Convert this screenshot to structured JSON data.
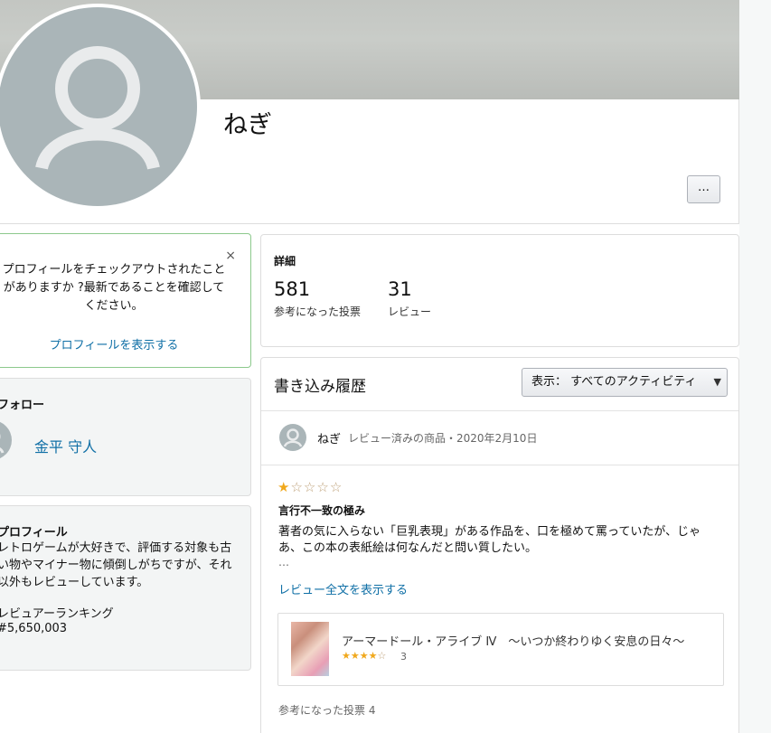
{
  "profile": {
    "name": "ねぎ",
    "more_label": "…"
  },
  "notice": {
    "close_label": "×",
    "text": "プロフィールをチェックアウトされたことがありますか ?最新であることを確認してください。",
    "link": "プロフィールを表示する"
  },
  "following": {
    "title": "フォロー",
    "name": "金平 守人"
  },
  "about": {
    "title": "プロフィール",
    "bio": "レトロゲームが大好きで、評価する対象も古い物やマイナー物に傾倒しがちですが、それ以外もレビューしています。",
    "ranking_label": "レビュアーランキング",
    "ranking_value": "#5,650,003"
  },
  "details": {
    "title": "詳細",
    "helpful_votes": "581",
    "helpful_votes_label": "参考になった投票",
    "reviews": "31",
    "reviews_label": "レビュー"
  },
  "history": {
    "title": "書き込み履歴",
    "filter_label": "表示： すべてのアクティビティ",
    "activity": {
      "user": "ねぎ",
      "meta": "レビュー済みの商品・2020年2月10日",
      "rating": 1,
      "max_rating": 5,
      "review_title": "言行不一致の極み",
      "review_body": "著者の気に入らない「巨乳表現」がある作品を、口を極めて罵っていたが、じゃあ、この本の表紙絵は何なんだと問い質したい。",
      "ellipsis": "…",
      "read_more": "レビュー全文を表示する",
      "product": {
        "title": "アーマードール・アライブ Ⅳ　～いつか終わりゆく安息の日々～",
        "rating": 4,
        "rating_count": "3"
      },
      "helpful": "参考になった投票 4"
    }
  },
  "colors": {
    "link": "#0f6fa6",
    "star": "#f0a81c",
    "avatar": "#aab5b8",
    "notice_border": "#8cc98c"
  }
}
